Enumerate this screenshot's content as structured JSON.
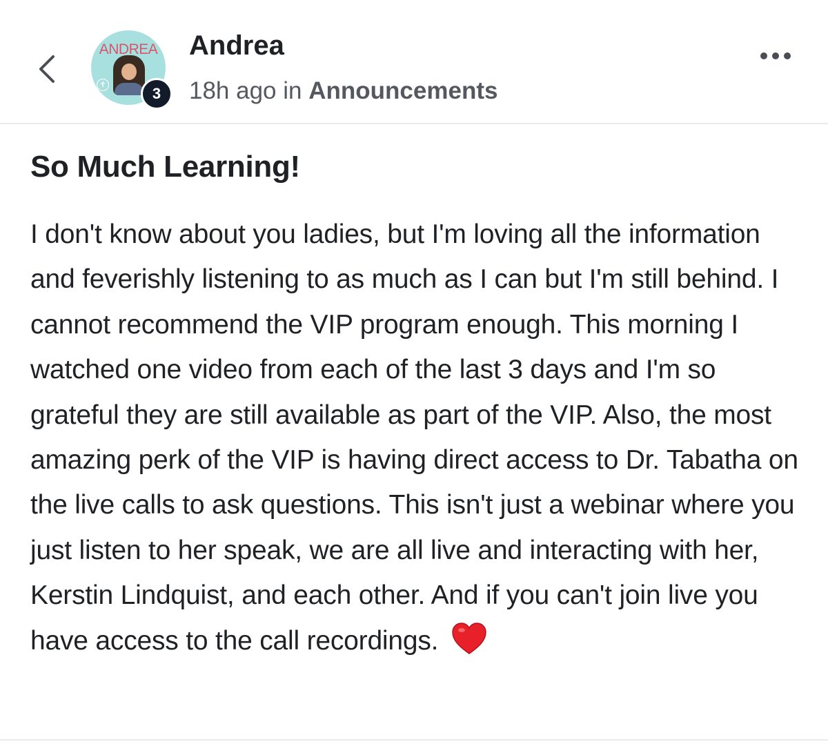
{
  "header": {
    "author": "Andrea",
    "avatar_text": "ANDREA",
    "level_badge": "3",
    "time_ago": "18h ago",
    "in_word": "in",
    "category": "Announcements",
    "icons": {
      "back": "chevron-left-icon",
      "more": "more-horizontal-icon"
    }
  },
  "post": {
    "title": "So Much Learning!",
    "body": "I don't know about you ladies, but I'm loving all the information and feverishly listening to as much as I can but I'm still behind. I cannot recommend the VIP program enough. This morning I watched one video from each of the last 3 days and I'm so grateful they are still available as part of the VIP. Also, the most amazing perk of the VIP is having direct access to Dr. Tabatha on the live calls to ask questions. This isn't just a webinar where you just listen to her speak, we are all live and interacting with her, Kerstin Lindquist, and each other. And if you can't join live you have access to the call recordings.",
    "emoji": "heart-icon"
  },
  "colors": {
    "text": "#1f2125",
    "meta": "#55595f",
    "avatar_bg": "#a8e0df",
    "avatar_text": "#d9546d",
    "badge_bg": "#121b2a",
    "heart": "#e8202a",
    "divider": "#e9eaec"
  }
}
